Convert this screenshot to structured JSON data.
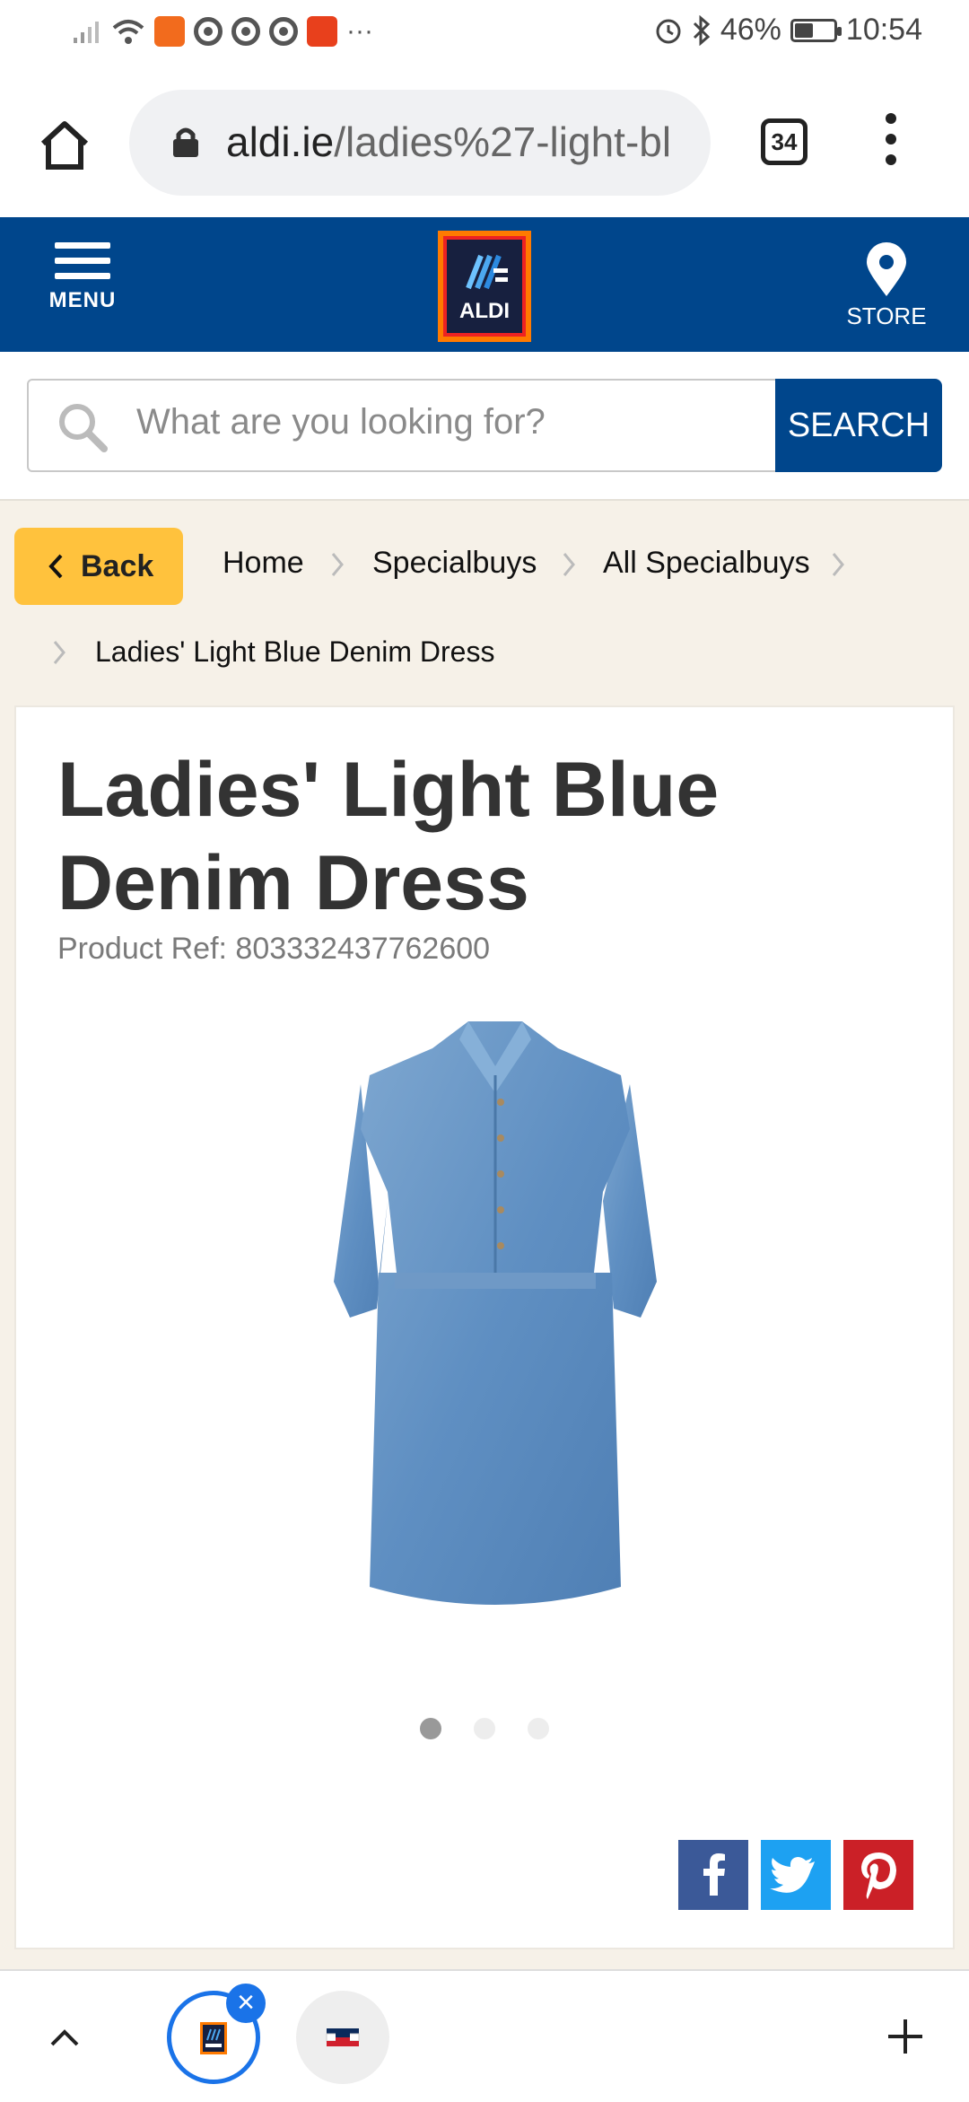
{
  "status_bar": {
    "battery": "46%",
    "time": "10:54",
    "more": "···"
  },
  "browser": {
    "url_host": "aldi.ie",
    "url_path": "/ladies%27-light-bl",
    "tab_count": "34"
  },
  "header": {
    "menu_label": "MENU",
    "logo_text": "ALDI",
    "store_label": "STORE"
  },
  "search": {
    "placeholder": "What are you looking for?",
    "button_label": "SEARCH"
  },
  "breadcrumb": {
    "back_label": "Back",
    "items": [
      "Home",
      "Specialbuys",
      "All Specialbuys",
      "Ladies' Light Blue Denim Dress"
    ]
  },
  "product": {
    "title": "Ladies' Light Blue Denim Dress",
    "ref": "Product Ref: 803332437762600",
    "image_count": 3,
    "active_image": 1
  },
  "share": [
    "facebook-icon",
    "twitter-icon",
    "pinterest-icon"
  ],
  "colors": {
    "brand_blue": "#00468c",
    "back_yellow": "#ffc23d",
    "page_bg": "#f6f1e8",
    "facebook": "#3b5998",
    "twitter": "#1da1f2",
    "pinterest": "#cb2027"
  }
}
